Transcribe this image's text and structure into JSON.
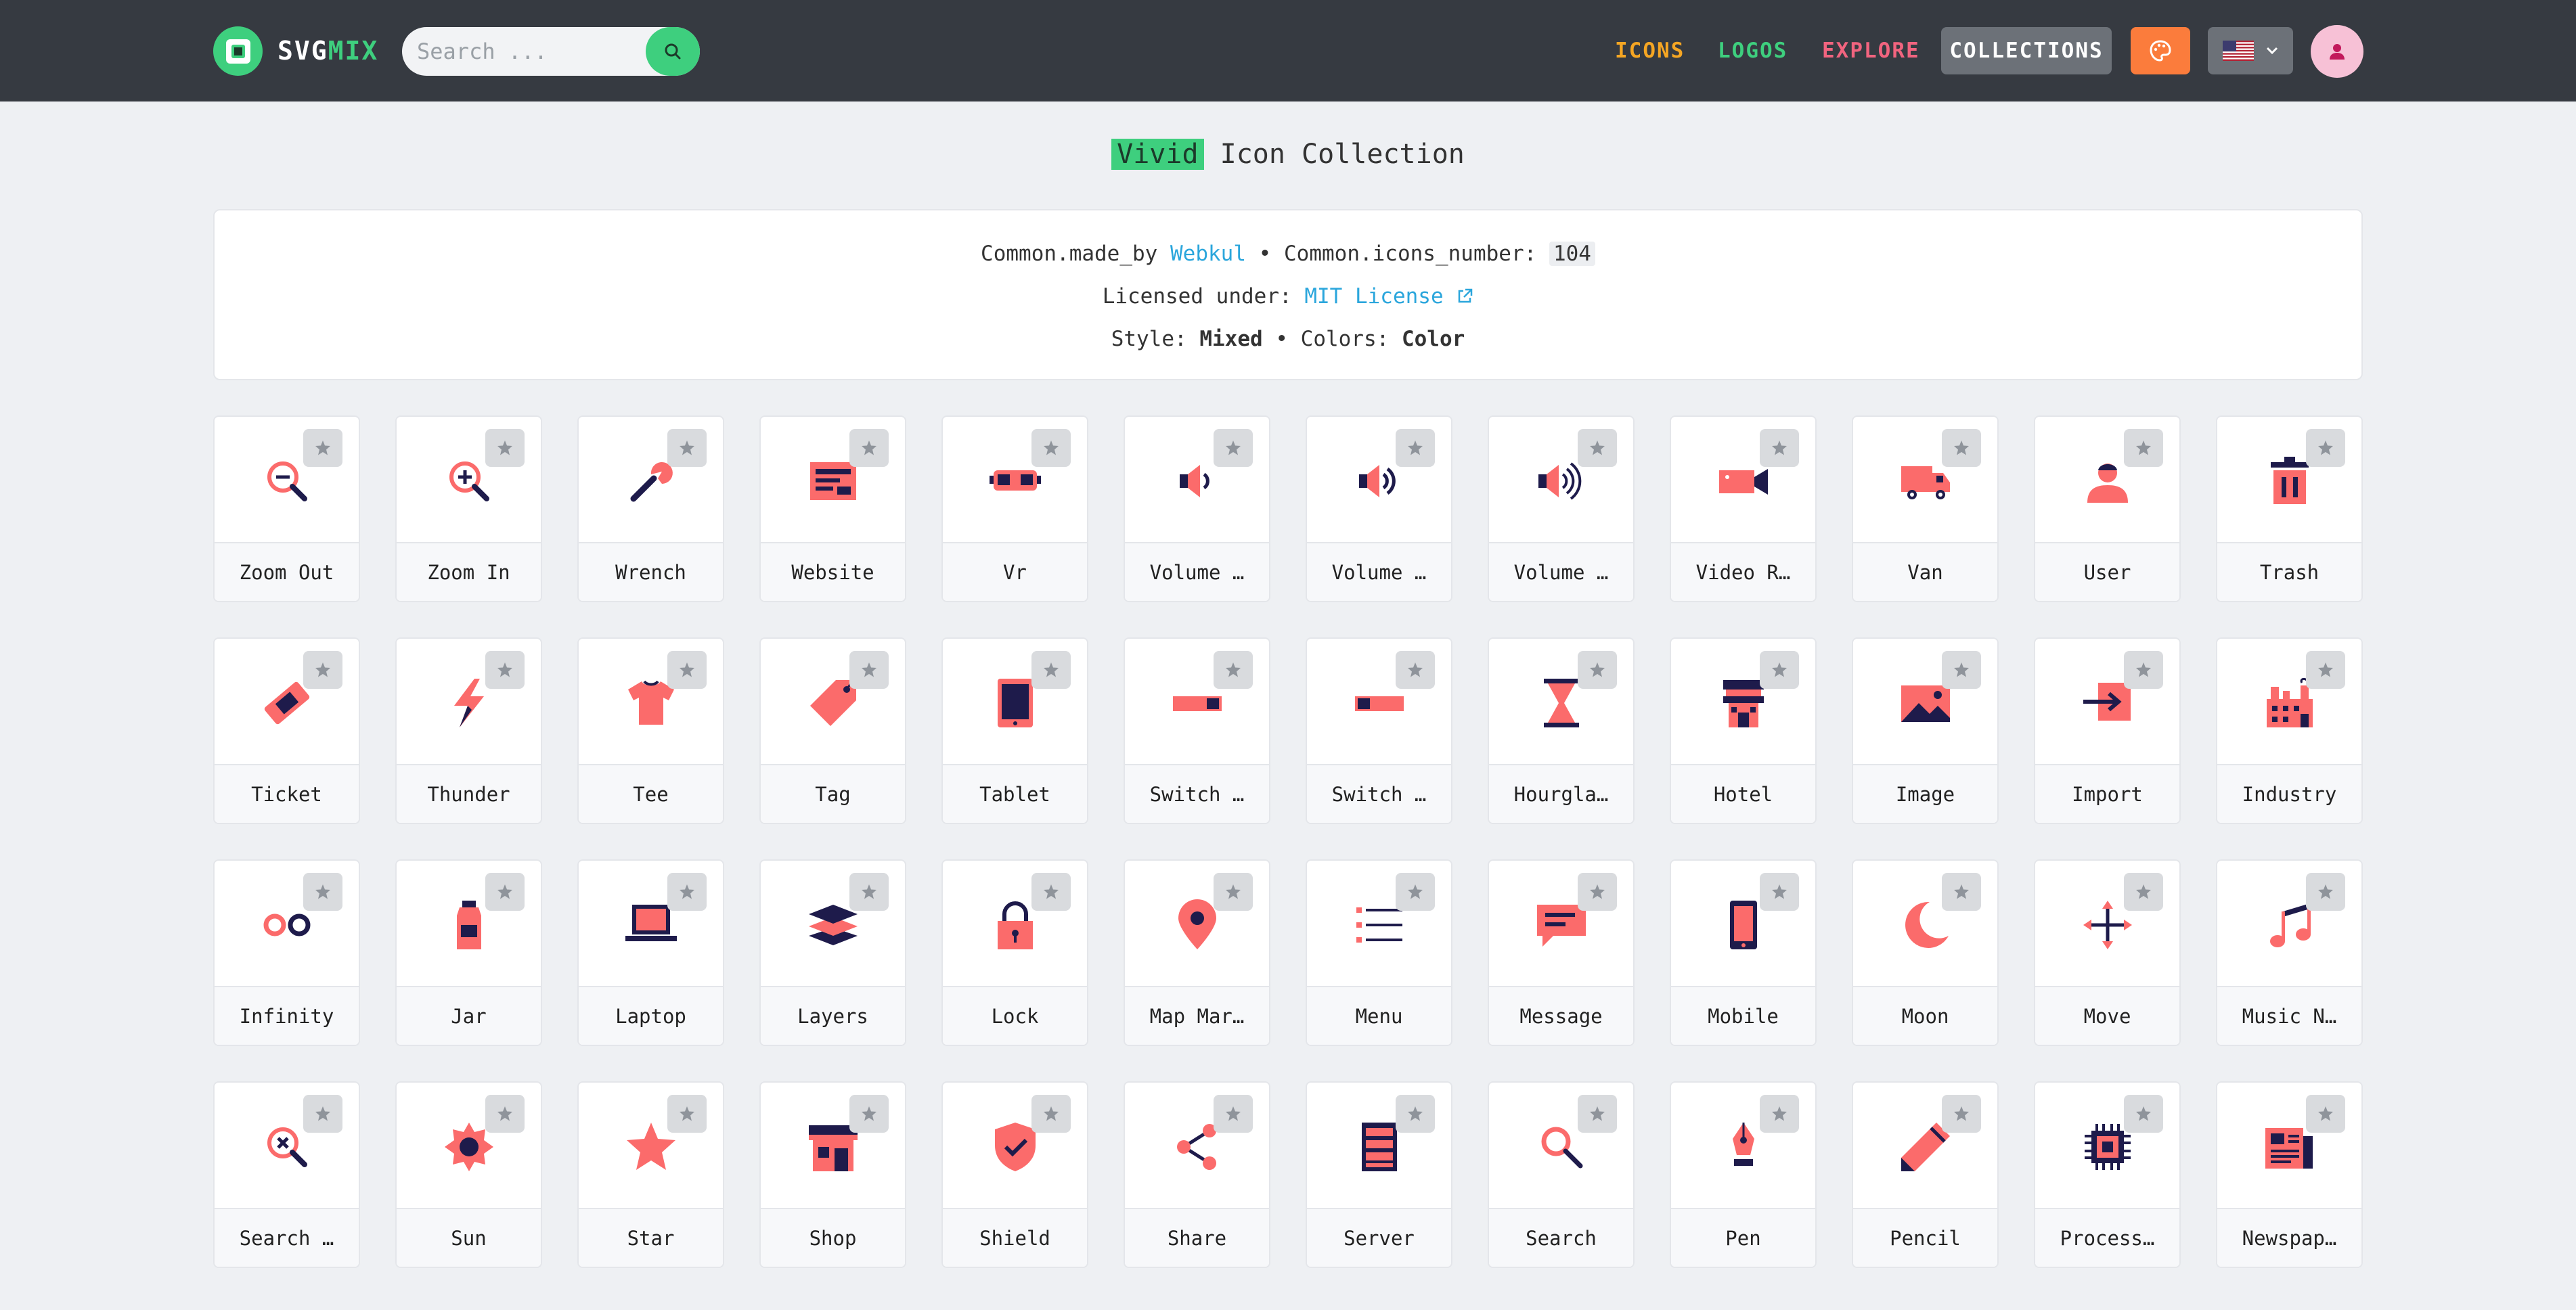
{
  "header": {
    "logo_a": "SVG",
    "logo_b": "MIX",
    "search_placeholder": "Search ...",
    "nav": {
      "icons": "ICONS",
      "logos": "LOGOS",
      "explore": "EXPLORE",
      "collections": "COLLECTIONS"
    },
    "colors": {
      "header_bg": "#363a41",
      "accent_green": "#3ecf7e",
      "icons": "#f6a623",
      "explore": "#f2647f",
      "palette_btn": "#fb7c3c"
    }
  },
  "title": {
    "highlight": "Vivid",
    "rest": " Icon Collection"
  },
  "info": {
    "made_by_label": "Common.made_by ",
    "author": "Webkul",
    "sep1": " • ",
    "icons_number_label": "Common.icons_number: ",
    "icons_number": "104",
    "license_label": "Licensed under: ",
    "license": "MIT License",
    "style_label": "Style: ",
    "style": "Mixed",
    "sep2": " • ",
    "colors_label": "Colors: ",
    "colors": "Color"
  },
  "icons": [
    {
      "label": "Zoom Out",
      "icon": "zoom-out-icon"
    },
    {
      "label": "Zoom In",
      "icon": "zoom-in-icon"
    },
    {
      "label": "Wrench",
      "icon": "wrench-icon"
    },
    {
      "label": "Website",
      "icon": "website-icon"
    },
    {
      "label": "Vr",
      "icon": "vr-icon"
    },
    {
      "label": "Volume …",
      "icon": "volume-low-icon"
    },
    {
      "label": "Volume …",
      "icon": "volume-mid-icon"
    },
    {
      "label": "Volume …",
      "icon": "volume-high-icon"
    },
    {
      "label": "Video R…",
      "icon": "video-recorder-icon"
    },
    {
      "label": "Van",
      "icon": "van-icon"
    },
    {
      "label": "User",
      "icon": "user-icon"
    },
    {
      "label": "Trash",
      "icon": "trash-icon"
    },
    {
      "label": "Ticket",
      "icon": "ticket-icon"
    },
    {
      "label": "Thunder",
      "icon": "thunder-icon"
    },
    {
      "label": "Tee",
      "icon": "tee-icon"
    },
    {
      "label": "Tag",
      "icon": "tag-icon"
    },
    {
      "label": "Tablet",
      "icon": "tablet-icon"
    },
    {
      "label": "Switch …",
      "icon": "switch-on-icon"
    },
    {
      "label": "Switch …",
      "icon": "switch-off-icon"
    },
    {
      "label": "Hourgla…",
      "icon": "hourglass-icon"
    },
    {
      "label": "Hotel",
      "icon": "hotel-icon"
    },
    {
      "label": "Image",
      "icon": "image-icon"
    },
    {
      "label": "Import",
      "icon": "import-icon"
    },
    {
      "label": "Industry",
      "icon": "industry-icon"
    },
    {
      "label": "Infinity",
      "icon": "infinity-icon"
    },
    {
      "label": "Jar",
      "icon": "jar-icon"
    },
    {
      "label": "Laptop",
      "icon": "laptop-icon"
    },
    {
      "label": "Layers",
      "icon": "layers-icon"
    },
    {
      "label": "Lock",
      "icon": "lock-icon"
    },
    {
      "label": "Map Mar…",
      "icon": "map-marker-icon"
    },
    {
      "label": "Menu",
      "icon": "menu-icon"
    },
    {
      "label": "Message",
      "icon": "message-icon"
    },
    {
      "label": "Mobile",
      "icon": "mobile-icon"
    },
    {
      "label": "Moon",
      "icon": "moon-icon"
    },
    {
      "label": "Move",
      "icon": "move-icon"
    },
    {
      "label": "Music N…",
      "icon": "music-note-icon"
    },
    {
      "label": "Search …",
      "icon": "search-close-icon"
    },
    {
      "label": "Sun",
      "icon": "sun-icon"
    },
    {
      "label": "Star",
      "icon": "star-icon"
    },
    {
      "label": "Shop",
      "icon": "shop-icon"
    },
    {
      "label": "Shield",
      "icon": "shield-icon"
    },
    {
      "label": "Share",
      "icon": "share-icon"
    },
    {
      "label": "Server",
      "icon": "server-icon"
    },
    {
      "label": "Search",
      "icon": "search-icon"
    },
    {
      "label": "Pen",
      "icon": "pen-icon"
    },
    {
      "label": "Pencil",
      "icon": "pencil-icon"
    },
    {
      "label": "Process…",
      "icon": "processor-icon"
    },
    {
      "label": "Newspap…",
      "icon": "newspaper-icon"
    }
  ]
}
